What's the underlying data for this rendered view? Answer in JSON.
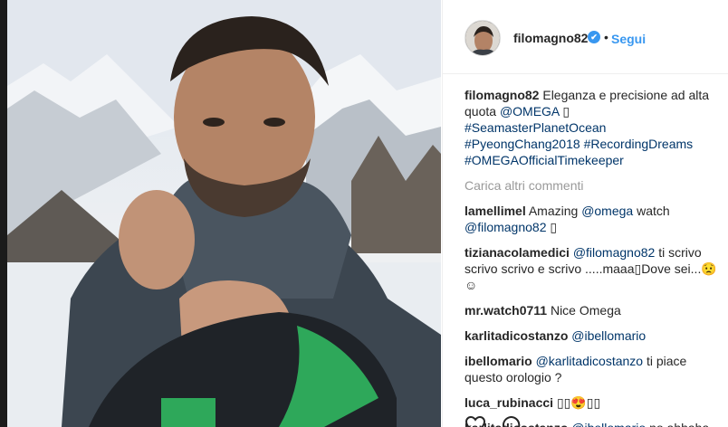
{
  "post": {
    "author": "filomagno82",
    "follow_label": "Segui",
    "separator": "•",
    "verified_mark": "✔"
  },
  "caption": {
    "username": "filomagno82",
    "text": "Eleganza e precisione ad alta quota",
    "mention": "@OMEGA",
    "glyph": "▯",
    "hashtags": [
      "#SeamasterPlanetOcean",
      "#PyeongChang2018",
      "#RecordingDreams",
      "#OMEGAOfficialTimekeeper"
    ]
  },
  "load_more": "Carica altri commenti",
  "comments": [
    {
      "user": "lamellimel",
      "parts": [
        {
          "t": "Amazing "
        },
        {
          "m": "@omega"
        },
        {
          "t": " watch "
        },
        {
          "m": "@filomagno82"
        },
        {
          "t": " ▯"
        }
      ]
    },
    {
      "user": "tizianacolamedici",
      "parts": [
        {
          "m": "@filomagno82"
        },
        {
          "t": " ti scrivo scrivo scrivo e scrivo .....maaa▯Dove sei...😟 ☺"
        }
      ]
    },
    {
      "user": "mr.watch0711",
      "parts": [
        {
          "t": "Nice Omega"
        }
      ]
    },
    {
      "user": "karlitadicostanzo",
      "parts": [
        {
          "m": "@ibellomario"
        }
      ]
    },
    {
      "user": "ibellomario",
      "parts": [
        {
          "m": "@karlitadicostanzo"
        },
        {
          "t": " ti piace questo orologio ?"
        }
      ]
    },
    {
      "user": "luca_rubinacci",
      "parts": [
        {
          "t": "▯▯😍▯▯"
        }
      ]
    },
    {
      "user": "karlitadicostanzo",
      "parts": [
        {
          "m": "@ibellomario"
        },
        {
          "t": " no ahhaha"
        }
      ]
    }
  ],
  "icons": {
    "like": "heart-icon",
    "comment": "comment-icon",
    "verified": "verified-badge-icon"
  },
  "colors": {
    "link": "#003569",
    "follow": "#3897f0",
    "muted": "#999999",
    "text": "#262626"
  }
}
